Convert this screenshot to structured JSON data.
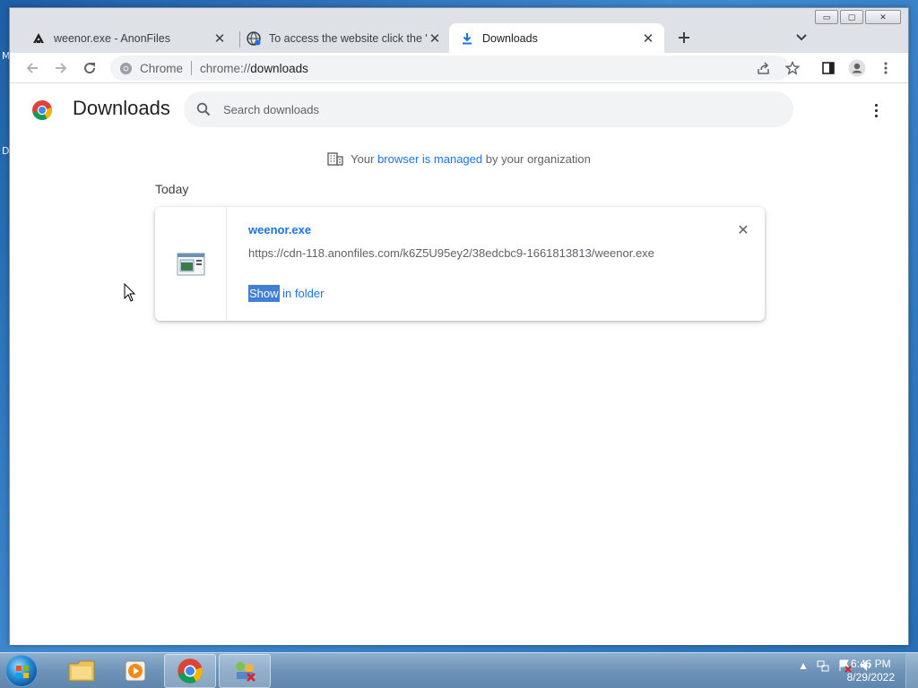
{
  "window": {
    "min_label": "▭",
    "max_label": "▢",
    "close_label": "✕"
  },
  "tabs": [
    {
      "title": "weenor.exe - AnonFiles",
      "close": "✕"
    },
    {
      "title": "To access the website click the \"A",
      "close": "✕"
    },
    {
      "title": "Downloads",
      "close": "✕"
    }
  ],
  "toolbar": {
    "omnibox_site": "Chrome",
    "url_scheme": "chrome://",
    "url_path": "downloads"
  },
  "page": {
    "title": "Downloads",
    "search_placeholder": "Search downloads",
    "managed_prefix": "Your",
    "managed_link": "browser is managed",
    "managed_suffix": "by your organization",
    "section_today": "Today"
  },
  "download": {
    "file_name": "weenor.exe",
    "url": "https://cdn-118.anonfiles.com/k6Z5U95ey2/38edcbc9-1661813813/weenor.exe",
    "action_selected": "Show",
    "action_rest": " in folder",
    "remove_label": "✕"
  },
  "taskbar": {
    "time": "6:46 PM",
    "date": "8/29/2022"
  },
  "desktop": {
    "glyph_m": "M",
    "glyph_d": "D"
  },
  "colors": {
    "accent": "#1a73e8",
    "selection": "#3f7fd6"
  }
}
